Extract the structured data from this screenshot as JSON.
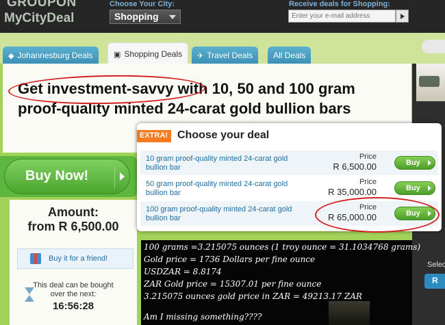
{
  "header": {
    "logo_line1": "GROUPON",
    "logo_line2": "MyCityDeal",
    "city_label": "Choose Your City:",
    "city_value": "Shopping",
    "receive_label": "Receive deals for Shopping:",
    "email_placeholder": "Enter your e-mail address"
  },
  "tabs": [
    {
      "label": "Johannesburg Deals",
      "icon": "tag-icon"
    },
    {
      "label": "Shopping Deals",
      "icon": "shopping-bag-icon"
    },
    {
      "label": "Travel Deals",
      "icon": "plane-icon"
    },
    {
      "label": "All Deals",
      "icon": "tag-icon"
    }
  ],
  "deal": {
    "title": "Get investment-savvy with 10, 50 and 100 gram proof-quality minted 24-carat gold bullion bars",
    "buy_now_label": "Buy Now!",
    "amount_label": "Amount:",
    "amount_value": "from R 6,500.00",
    "friend_label": "Buy it for a friend!",
    "bought_text": "This deal can be bought over the next:",
    "timer": "16:56:28"
  },
  "modal": {
    "badge": "EXTRA!",
    "title": "Choose your deal",
    "price_label": "Price",
    "buy_label": "Buy",
    "options": [
      {
        "name": "10 gram proof-quality minted 24-carat gold bullion bar",
        "price": "R 6,500.00"
      },
      {
        "name": "50 gram proof-quality minted 24-carat gold bullion bar",
        "price": "R 35,000.00"
      },
      {
        "name": "100 gram proof-quality minted 24-carat gold bullion bar",
        "price": "R 65,000.00"
      }
    ]
  },
  "note": {
    "lines": [
      "100 grams =3.215075 ounces (1 troy ounce = 31.1034768 grams)",
      "Gold price = 1736 Dollars per fine ounce",
      "USDZAR = 8.8174",
      "ZAR Gold price  = 15307.01 per fine ounce",
      "3.215075 ounces gold price in ZAR = 49213.17 ZAR",
      "Am I missing something????"
    ]
  },
  "right_edge": {
    "text": "Selec",
    "badge": "R"
  },
  "colors": {
    "accent_green": "#5db73f",
    "link_blue": "#1c6ea4",
    "annotation_red": "#d42020",
    "extra_orange": "#f47b20"
  }
}
